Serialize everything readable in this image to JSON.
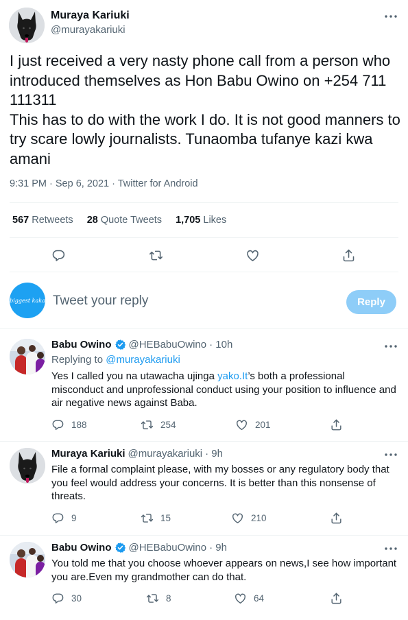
{
  "main_tweet": {
    "author_name": "Muraya Kariuki",
    "author_handle": "@murayakariuki",
    "text": "I just received a very nasty phone call from a person who introduced themselves as Hon Babu Owino on +254 711 111311\nThis has to do with the work I do. It is not good manners to try scare lowly journalists. Tunaomba tufanye kazi kwa amani",
    "meta": "9:31 PM · Sep 6, 2021 · Twitter for Android",
    "stats": {
      "retweets_count": "567",
      "retweets_label": "Retweets",
      "quotes_count": "28",
      "quotes_label": "Quote Tweets",
      "likes_count": "1,705",
      "likes_label": "Likes"
    }
  },
  "composer": {
    "avatar_text": "biggest kaka",
    "placeholder": "Tweet your reply",
    "reply_label": "Reply"
  },
  "replies": [
    {
      "author_name": "Babu Owino",
      "author_handle": "@HEBabuOwino",
      "time": "· 10h",
      "verified": true,
      "replying_prefix": "Replying to",
      "replying_to": "@murayakariuki",
      "text_before_link": "Yes I called you na utawacha ujinga ",
      "link_text": "yako.It",
      "text_after_link": "’s both a professional misconduct and unprofessional conduct using your position to influence and air negative news against Baba.",
      "replies_count": "188",
      "retweets_count": "254",
      "likes_count": "201"
    },
    {
      "author_name": "Muraya Kariuki",
      "author_handle": "@murayakariuki",
      "time": "· 9h",
      "verified": false,
      "text": "File a formal complaint please, with my bosses or any regulatory body that you feel would address your concerns. It is better than this nonsense of threats.",
      "replies_count": "9",
      "retweets_count": "15",
      "likes_count": "210"
    },
    {
      "author_name": "Babu Owino",
      "author_handle": "@HEBabuOwino",
      "time": "· 9h",
      "verified": true,
      "text": "You told me that you choose whoever appears on news,I see how important you are.Even my grandmother can do that.",
      "replies_count": "30",
      "retweets_count": "8",
      "likes_count": "64"
    }
  ],
  "icons": {
    "reply": "reply-icon",
    "retweet": "retweet-icon",
    "like": "heart-icon",
    "share": "share-icon",
    "more": "more-icon",
    "verified": "verified-badge-icon"
  },
  "colors": {
    "accent": "#1d9bf0",
    "reply_button_disabled": "#8ecdf8",
    "secondary_text": "#536471"
  }
}
